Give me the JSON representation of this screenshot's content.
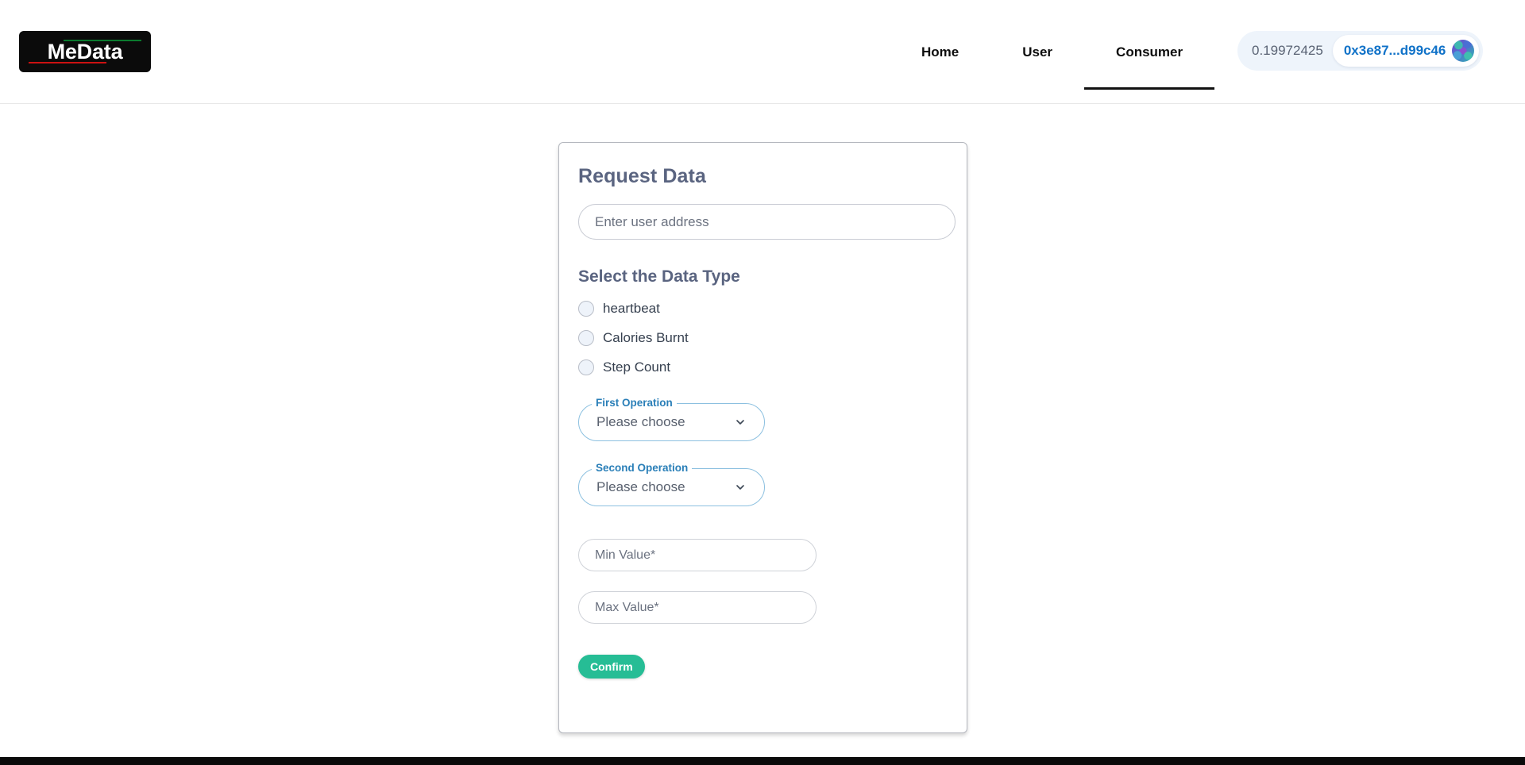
{
  "header": {
    "logo": {
      "text": "MeData",
      "accent_green": "#0a7a2e",
      "accent_red": "#cc1111",
      "background": "#0b0b0b"
    },
    "nav": [
      {
        "label": "Home",
        "active": false
      },
      {
        "label": "User",
        "active": false
      },
      {
        "label": "Consumer",
        "active": true
      }
    ],
    "wallet": {
      "balance": "0.19972425",
      "address": "0x3e87...d99c46",
      "address_color": "#1072c8",
      "pill_background": "#eef4fb",
      "avatar_icon": "wallet-avatar-icon"
    }
  },
  "card": {
    "title": "Request Data",
    "user_address": {
      "placeholder": "Enter user address",
      "value": ""
    },
    "data_type": {
      "section_label": "Select the Data Type",
      "options": [
        {
          "label": "heartbeat",
          "selected": false
        },
        {
          "label": "Calories Burnt",
          "selected": false
        },
        {
          "label": "Step Count",
          "selected": false
        }
      ]
    },
    "first_operation": {
      "label": "First Operation",
      "value": "Please choose",
      "chevron_icon": "chevron-down-icon"
    },
    "second_operation": {
      "label": "Second Operation",
      "value": "Please choose",
      "chevron_icon": "chevron-down-icon"
    },
    "min_value": {
      "placeholder": "Min Value*",
      "value": ""
    },
    "max_value": {
      "placeholder": "Max Value*",
      "value": ""
    },
    "confirm": {
      "label": "Confirm",
      "color": "#26bd95"
    }
  }
}
